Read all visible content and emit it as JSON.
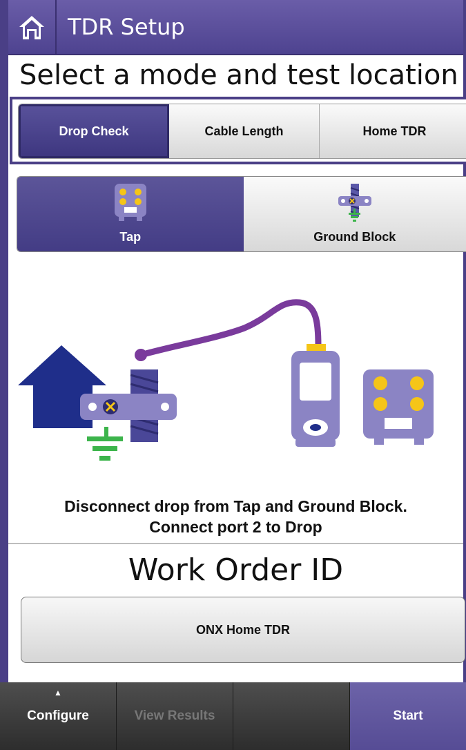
{
  "header": {
    "title": "TDR Setup",
    "home_icon": "home-icon",
    "color": "#5b4f9c"
  },
  "subtitle": "Select a mode and test location",
  "modes": {
    "selected": "Drop Check",
    "items": [
      {
        "label": "Drop Check"
      },
      {
        "label": "Cable Length"
      },
      {
        "label": "Home TDR"
      }
    ]
  },
  "locations": {
    "selected": "Tap",
    "items": [
      {
        "label": "Tap",
        "icon": "tap-icon"
      },
      {
        "label": "Ground Block",
        "icon": "ground-block-icon"
      }
    ]
  },
  "instruction": {
    "line1": "Disconnect drop from Tap and Ground Block.",
    "line2": "Connect port 2 to Drop"
  },
  "work_order": {
    "title": "Work Order ID",
    "value": "ONX Home TDR"
  },
  "toolbar": {
    "configure": "Configure",
    "view_results": "View Results",
    "empty": "",
    "start": "Start"
  },
  "colors": {
    "accent": "#4a3f86",
    "yellow": "#f5c518",
    "green": "#3cb44b",
    "house": "#1f2e8a",
    "cable": "#7a3b9c"
  }
}
